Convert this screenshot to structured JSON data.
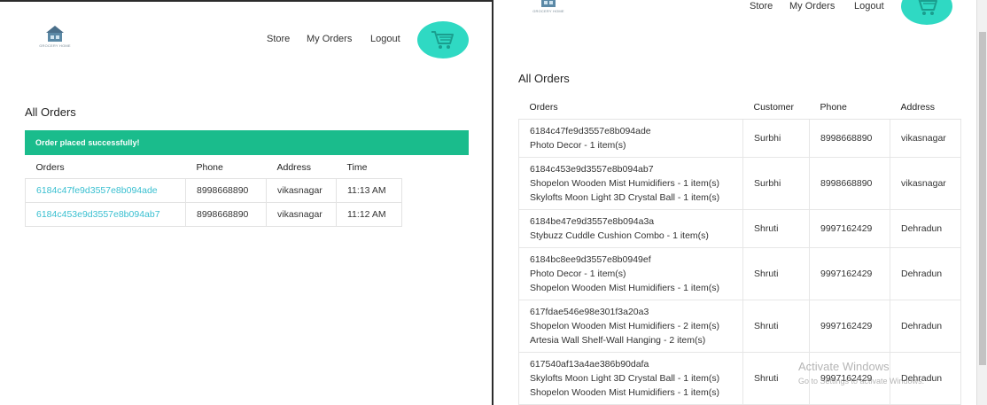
{
  "left": {
    "brand": "GROCERY HOME",
    "nav": {
      "store": "Store",
      "my_orders": "My Orders",
      "logout": "Logout"
    },
    "heading": "All Orders",
    "alert": "Order placed successfully!",
    "columns": [
      "Orders",
      "Phone",
      "Address",
      "Time"
    ],
    "rows": [
      {
        "order": "6184c47fe9d3557e8b094ade",
        "phone": "8998668890",
        "address": "vikasnagar",
        "time": "11:13 AM"
      },
      {
        "order": "6184c453e9d3557e8b094ab7",
        "phone": "8998668890",
        "address": "vikasnagar",
        "time": "11:12 AM"
      }
    ]
  },
  "right": {
    "brand": "GROCERY HOME",
    "nav": {
      "store": "Store",
      "my_orders": "My Orders",
      "logout": "Logout"
    },
    "heading": "All Orders",
    "columns": [
      "Orders",
      "Customer",
      "Phone",
      "Address"
    ],
    "rows": [
      {
        "order": "6184c47fe9d3557e8b094ade",
        "items": [
          "Photo Decor - 1 item(s)"
        ],
        "customer": "Surbhi",
        "phone": "8998668890",
        "address": "vikasnagar"
      },
      {
        "order": "6184c453e9d3557e8b094ab7",
        "items": [
          "Shopelon Wooden Mist Humidifiers - 1 item(s)",
          "Skylofts Moon Light 3D Crystal Ball - 1 item(s)"
        ],
        "customer": "Surbhi",
        "phone": "8998668890",
        "address": "vikasnagar"
      },
      {
        "order": "6184be47e9d3557e8b094a3a",
        "items": [
          "Stybuzz Cuddle Cushion Combo - 1 item(s)"
        ],
        "customer": "Shruti",
        "phone": "9997162429",
        "address": "Dehradun"
      },
      {
        "order": "6184bc8ee9d3557e8b0949ef",
        "items": [
          "Photo Decor - 1 item(s)",
          "Shopelon Wooden Mist Humidifiers - 1 item(s)"
        ],
        "customer": "Shruti",
        "phone": "9997162429",
        "address": "Dehradun"
      },
      {
        "order": "617fdae546e98e301f3a20a3",
        "items": [
          "Shopelon Wooden Mist Humidifiers - 2 item(s)",
          "Artesia Wall Shelf-Wall Hanging - 2 item(s)"
        ],
        "customer": "Shruti",
        "phone": "9997162429",
        "address": "Dehradun"
      },
      {
        "order": "617540af13a4ae386b90dafa",
        "items": [
          "Skylofts Moon Light 3D Crystal Ball - 1 item(s)",
          "Shopelon Wooden Mist Humidifiers - 1 item(s)"
        ],
        "customer": "Shruti",
        "phone": "9997162429",
        "address": "Dehradun"
      }
    ]
  },
  "watermark": {
    "title": "Activate Windows",
    "subtitle": "Go to Settings to activate Windows."
  },
  "colors": {
    "accent": "#2fd9c3",
    "alert": "#1abc8c",
    "link": "#38bfd0"
  },
  "icons": {
    "cart": "shopping-cart-icon",
    "logo": "house-logo-icon"
  }
}
